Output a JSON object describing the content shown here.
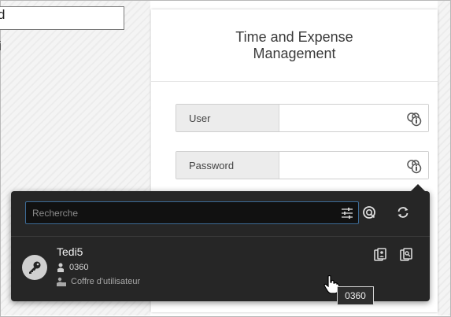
{
  "background_fragments": {
    "top_text": "d",
    "bottom_text": "i"
  },
  "login": {
    "title": "Time and Expense Management",
    "user_label": "User",
    "user_value": "",
    "password_label": "Password",
    "password_value": ""
  },
  "popup": {
    "search_placeholder": "Recherche",
    "entry": {
      "name": "Tedi5",
      "username": "0360",
      "vault": "Coffre d'utilisateur"
    },
    "tooltip": "0360"
  },
  "colors": {
    "popup_bg": "#262626",
    "search_border": "#3d6b96"
  }
}
